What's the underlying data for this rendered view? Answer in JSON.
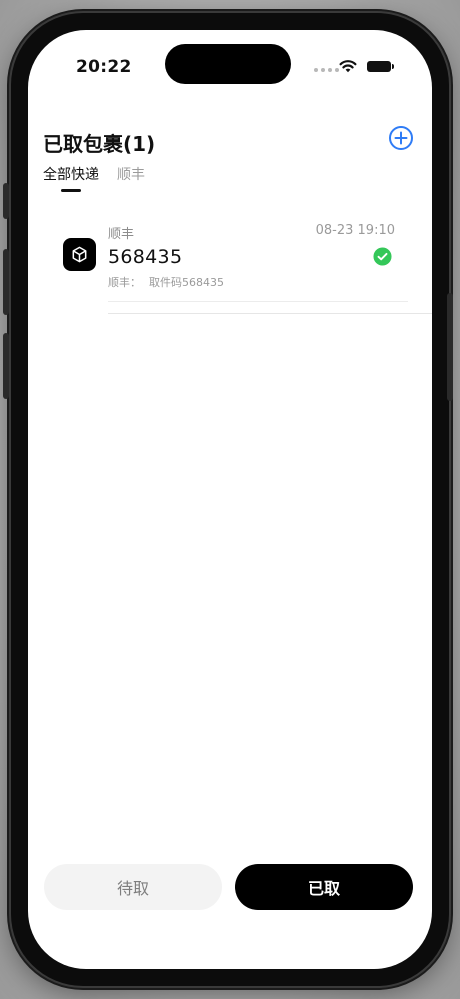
{
  "status_bar": {
    "time": "20:22"
  },
  "header": {
    "title": "已取包裹(1)"
  },
  "tabs": [
    {
      "label": "全部快递",
      "active": true
    },
    {
      "label": "顺丰",
      "active": false
    }
  ],
  "packages": [
    {
      "carrier": "顺丰",
      "time": "08-23 19:10",
      "code": "568435",
      "note_label": "顺丰：",
      "note_text": "取件码568435",
      "status": "picked-up"
    }
  ],
  "bottom_buttons": {
    "pending_label": "待取",
    "picked_label": "已取"
  },
  "icons": {
    "add": "plus-circle-icon",
    "package": "cube-icon",
    "status": "check-circle-icon"
  },
  "colors": {
    "accent": "#2f7cf6",
    "success": "#34c759",
    "primary_button": "#000000"
  }
}
